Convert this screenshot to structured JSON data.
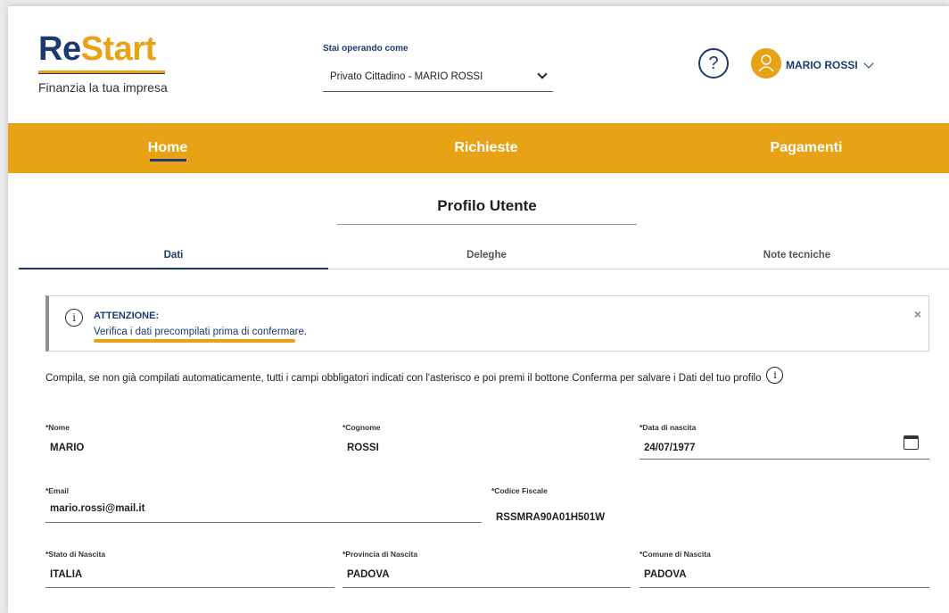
{
  "brand": {
    "re": "Re",
    "start": "Start",
    "tagline": "Finanzia la tua impresa"
  },
  "operating_as": {
    "label": "Stai operando come",
    "value": "Privato Cittadino - MARIO ROSSI"
  },
  "user": {
    "name": "MARIO ROSSI"
  },
  "icons": {
    "help": "help-icon",
    "user": "user-icon",
    "info": "info-icon",
    "close": "close-icon",
    "calendar": "calendar-icon",
    "chevron": "chevron-down-icon"
  },
  "colors": {
    "brand_blue": "#1d3a70",
    "accent": "#e8a216"
  },
  "nav": {
    "home": "Home",
    "richieste": "Richieste",
    "pagamenti": "Pagamenti"
  },
  "page": {
    "title": "Profilo Utente"
  },
  "tabs": {
    "dati": "Dati",
    "deleghe": "Deleghe",
    "note": "Note tecniche"
  },
  "alert": {
    "title": "ATTENZIONE:",
    "message": "Verifica i dati precompilati prima di confermare.",
    "close": "×"
  },
  "instructions": "Compila, se non già compilati automaticamente, tutti i campi obbligatori indicati con l'asterisco e poi premi il bottone Conferma per salvare i Dati del tuo profilo",
  "fields": {
    "nome": {
      "label": "*Nome",
      "value": "MARIO"
    },
    "cognome": {
      "label": "*Cognome",
      "value": "ROSSI"
    },
    "data_nascita": {
      "label": "*Data di nascita",
      "value": "24/07/1977"
    },
    "email": {
      "label": "*Email",
      "value": "mario.rossi@mail.it"
    },
    "codice_fiscale": {
      "label": "*Codice Fiscale",
      "value": "RSSMRA90A01H501W"
    },
    "stato_nascita": {
      "label": "*Stato di Nascita",
      "value": "ITALIA"
    },
    "provincia_nascita": {
      "label": "*Provincia di Nascita",
      "value": "PADOVA"
    },
    "comune_nascita": {
      "label": "*Comune di Nascita",
      "value": "PADOVA"
    }
  }
}
